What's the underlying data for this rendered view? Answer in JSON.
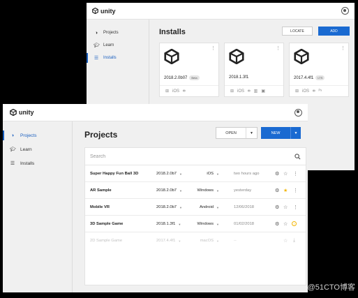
{
  "back_window": {
    "brand": "unity",
    "sidebar": [
      {
        "label": "Projects",
        "icon": "cube-icon",
        "active": false
      },
      {
        "label": "Learn",
        "icon": "graduation-cap-icon",
        "active": false
      },
      {
        "label": "Installs",
        "icon": "list-icon",
        "active": true
      }
    ],
    "title": "Installs",
    "locate_label": "LOCATE",
    "add_label": "ADD",
    "installs": [
      {
        "version": "2018.2.0b07",
        "badge": "Beta",
        "platforms": [
          "windows-icon",
          "iOS",
          "android-icon"
        ]
      },
      {
        "version": "2018.1.3f1",
        "badge": "",
        "platforms": [
          "windows-icon",
          "iOS",
          "android-icon",
          "archive-icon",
          "console-icon"
        ]
      },
      {
        "version": "2017.4.4f1",
        "badge": "LTS",
        "platforms": [
          "windows-icon",
          "iOS",
          "android-icon",
          "playstation-icon"
        ]
      }
    ]
  },
  "front_window": {
    "brand": "unity",
    "sidebar": [
      {
        "label": "Projects",
        "icon": "cube-icon",
        "active": true
      },
      {
        "label": "Learn",
        "icon": "graduation-cap-icon",
        "active": false
      },
      {
        "label": "Installs",
        "icon": "list-icon",
        "active": false
      }
    ],
    "title": "Projects",
    "open_label": "OPEN",
    "new_label": "NEW",
    "search_placeholder": "Search",
    "projects": [
      {
        "name": "Super Happy Fun Ball 3D",
        "version": "2018.2.0b7",
        "platform": "iOS",
        "modified": "two hours ago",
        "starred": false,
        "status": "more"
      },
      {
        "name": "AR Sample",
        "version": "2018.2.0b7",
        "platform": "Windows",
        "modified": "yesterday",
        "starred": true,
        "status": "more"
      },
      {
        "name": "Mobile VR",
        "version": "2018.2.0b7",
        "platform": "Android",
        "modified": "12/06/2018",
        "starred": false,
        "status": "more"
      },
      {
        "name": "3D Sample Game",
        "version": "2018.1.3f1",
        "platform": "Windows",
        "modified": "01/02/2018",
        "starred": false,
        "status": "warning"
      },
      {
        "name": "2D Sample Game",
        "version": "2017.4.4f1",
        "platform": "macOS",
        "modified": "--",
        "starred": false,
        "status": "download"
      }
    ]
  },
  "watermark": "@51CTO博客",
  "colors": {
    "accent": "#1a6ad1",
    "star": "#f2b400",
    "background": "#000000"
  }
}
